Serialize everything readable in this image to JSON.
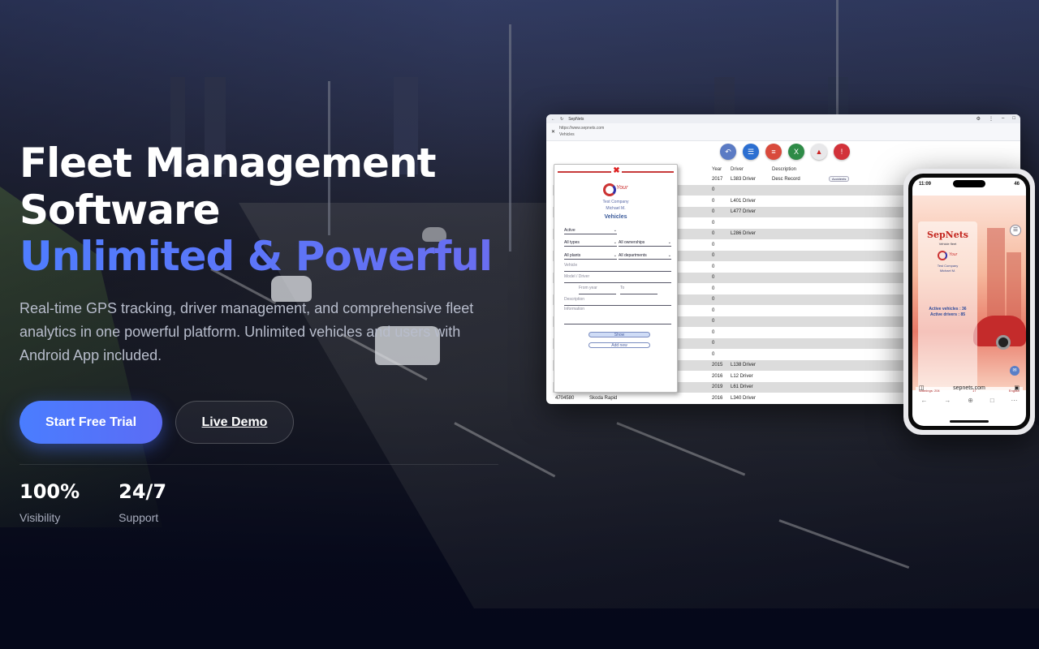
{
  "hero": {
    "title_line1": "Fleet Management",
    "title_line2": "Software",
    "title_line3": "Unlimited & Powerful",
    "subtitle": "Real-time GPS tracking, driver management, and comprehensive fleet analytics in one powerful platform. Unlimited vehicles and users with Android App included.",
    "primary_cta": "Start Free Trial",
    "secondary_cta": "Live Demo"
  },
  "stats": [
    {
      "value": "100%",
      "label": "Visibility"
    },
    {
      "value": "24/7",
      "label": "Support"
    }
  ],
  "colors": {
    "accent_gradient_start": "#4f7dff",
    "accent_gradient_end": "#6a6df0",
    "background": "#05081a"
  },
  "desktop_app": {
    "tab_title": "SepNets",
    "url": "https://www.sepnets.com",
    "page_name": "Vehicles",
    "toolbar_icons": [
      "back-icon",
      "list-icon",
      "filter-icon",
      "excel-icon",
      "pdf-icon",
      "report-icon"
    ],
    "columns": [
      "Year",
      "Driver",
      "Description"
    ],
    "rows": [
      {
        "plate": "",
        "model": "",
        "year": "2017",
        "driver": "L383 Driver",
        "desc": "Desc Record",
        "tag": "Accidents"
      },
      {
        "plate": "",
        "model": "",
        "year": "0",
        "driver": "",
        "desc": "",
        "tag": ""
      },
      {
        "plate": "",
        "model": "",
        "year": "0",
        "driver": "L401 Driver",
        "desc": "",
        "tag": ""
      },
      {
        "plate": "",
        "model": "",
        "year": "0",
        "driver": "L477 Driver",
        "desc": "",
        "tag": ""
      },
      {
        "plate": "",
        "model": "",
        "year": "0",
        "driver": "",
        "desc": "",
        "tag": ""
      },
      {
        "plate": "",
        "model": "",
        "year": "0",
        "driver": "L286 Driver",
        "desc": "",
        "tag": ""
      },
      {
        "plate": "",
        "model": "",
        "year": "0",
        "driver": "",
        "desc": "",
        "tag": ""
      },
      {
        "plate": "",
        "model": "",
        "year": "0",
        "driver": "",
        "desc": "",
        "tag": ""
      },
      {
        "plate": "",
        "model": "",
        "year": "0",
        "driver": "",
        "desc": "",
        "tag": ""
      },
      {
        "plate": "",
        "model": "",
        "year": "0",
        "driver": "",
        "desc": "",
        "tag": ""
      },
      {
        "plate": "",
        "model": "",
        "year": "0",
        "driver": "",
        "desc": "",
        "tag": ""
      },
      {
        "plate": "",
        "model": "",
        "year": "0",
        "driver": "",
        "desc": "",
        "tag": ""
      },
      {
        "plate": "",
        "model": "",
        "year": "0",
        "driver": "",
        "desc": "",
        "tag": ""
      },
      {
        "plate": "",
        "model": "",
        "year": "0",
        "driver": "",
        "desc": "",
        "tag": ""
      },
      {
        "plate": "",
        "model": "",
        "year": "0",
        "driver": "",
        "desc": "",
        "tag": ""
      },
      {
        "plate": "",
        "model": "",
        "year": "0",
        "driver": "",
        "desc": "",
        "tag": ""
      },
      {
        "plate": "",
        "model": "",
        "year": "0",
        "driver": "",
        "desc": "",
        "tag": ""
      },
      {
        "plate": "",
        "model": "",
        "year": "2015",
        "driver": "L138 Driver",
        "desc": "",
        "tag": ""
      },
      {
        "plate": "",
        "model": "",
        "year": "2016",
        "driver": "L12 Driver",
        "desc": "",
        "tag": ""
      },
      {
        "plate": "",
        "model": "",
        "year": "2019",
        "driver": "L61 Driver",
        "desc": "",
        "tag": ""
      },
      {
        "plate": "4704580",
        "model": "Skoda Rapid",
        "year": "2016",
        "driver": "L340 Driver",
        "desc": "",
        "tag": ""
      }
    ],
    "panel": {
      "logo_text": "Your",
      "company": "Test Company",
      "user": "Michael M.",
      "heading": "Vehicles",
      "status_select": "Active",
      "types_select": "All types",
      "ownerships_select": "All ownerships",
      "plants_select": "All plants",
      "departments_select": "All departments",
      "vehicle_placeholder": "Vehicle",
      "model_placeholder": "Model / Driver",
      "from_year_placeholder": "From year",
      "to_placeholder": "To",
      "description_placeholder": "Description",
      "information_placeholder": "Information",
      "show_button": "Show",
      "add_button": "Add new"
    }
  },
  "phone_app": {
    "time": "11:09",
    "battery": "46",
    "brand": "SepNets",
    "subbrand": "Vehicle fleet",
    "logo_text": "Your",
    "company": "Test Company",
    "user": "Michael M.",
    "active_vehicles": "Active vehicles : 36",
    "active_drivers": "Active drivers : 85",
    "warnings": "Warnings: 204",
    "count": "17",
    "language": "English",
    "url": "sepnets.com"
  }
}
